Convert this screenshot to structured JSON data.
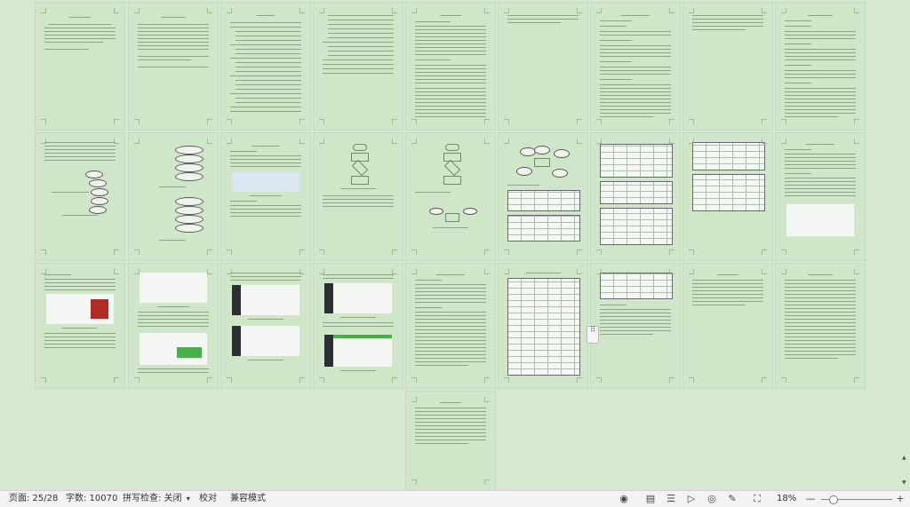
{
  "statusbar": {
    "page": "页面: 25/28",
    "words": "字数: 10070",
    "spell": "拼写检查: 关闭",
    "spell_arrow": "▾",
    "proof": "校对",
    "compat": "兼容模式",
    "zoom": "18%"
  },
  "icons": {
    "eye": "◉",
    "page_view": "▤",
    "outline": "☰",
    "play": "▷",
    "web": "◎",
    "pen": "✎",
    "fit": "⛶",
    "zoom_out": "—",
    "zoom_in": "+",
    "handle": "⠿",
    "up": "▲",
    "down": "▼"
  },
  "zoom_level": 0.18
}
